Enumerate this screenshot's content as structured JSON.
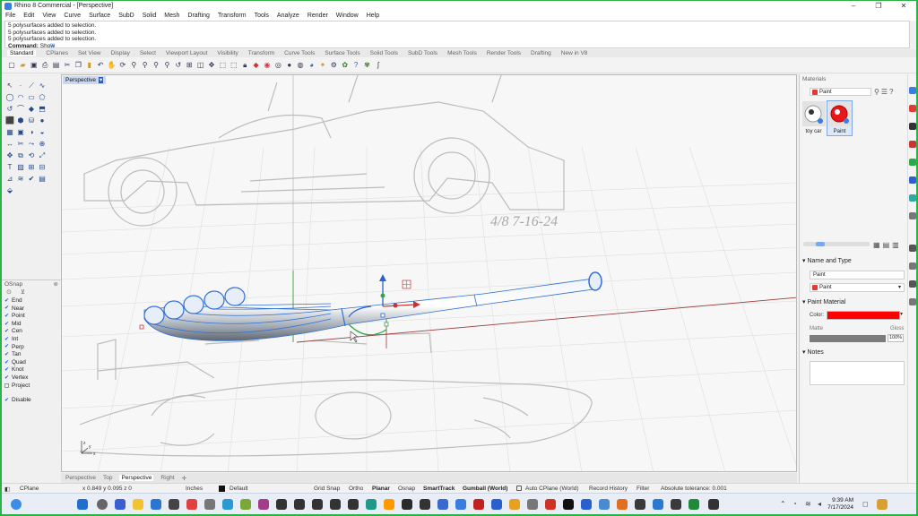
{
  "window": {
    "title": "Rhino 8 Commercial - [Perspective]",
    "controls": [
      "–",
      "❐",
      "✕"
    ]
  },
  "menu": [
    "File",
    "Edit",
    "View",
    "Curve",
    "Surface",
    "SubD",
    "Solid",
    "Mesh",
    "Drafting",
    "Transform",
    "Tools",
    "Analyze",
    "Render",
    "Window",
    "Help"
  ],
  "command_history": {
    "lines": [
      "5 polysurfaces added to selection.",
      "5 polysurfaces added to selection.",
      "5 polysurfaces added to selection."
    ],
    "prompt_label": "Command:",
    "typed_text": "Sho",
    "typed_highlight": "w"
  },
  "toolbar_tabs": [
    "Standard",
    "CPlanes",
    "Set View",
    "Display",
    "Select",
    "Viewport Layout",
    "Visibility",
    "Transform",
    "Curve Tools",
    "Surface Tools",
    "Solid Tools",
    "SubD Tools",
    "Mesh Tools",
    "Render Tools",
    "Drafting",
    "New in V8"
  ],
  "viewport": {
    "label": "Perspective",
    "sketch_date": "4/8 7-16-24"
  },
  "osnap": {
    "title": "OSnap",
    "items": [
      {
        "label": "End",
        "checked": true
      },
      {
        "label": "Near",
        "checked": true
      },
      {
        "label": "Point",
        "checked": true
      },
      {
        "label": "Mid",
        "checked": true
      },
      {
        "label": "Cen",
        "checked": true
      },
      {
        "label": "Int",
        "checked": true
      },
      {
        "label": "Perp",
        "checked": true
      },
      {
        "label": "Tan",
        "checked": true
      },
      {
        "label": "Quad",
        "checked": true
      },
      {
        "label": "Knot",
        "checked": true
      },
      {
        "label": "Vertex",
        "checked": true
      },
      {
        "label": "Project",
        "checked": false
      }
    ],
    "disable": {
      "label": "Disable",
      "checked": true
    }
  },
  "view_tabs": [
    "Perspective",
    "Top",
    "Perspective",
    "Right"
  ],
  "status": {
    "cplane": "CPlane",
    "coords": "x 0.849  y 0.095  z 0",
    "units": "Inches",
    "layer": "Default",
    "grid_snap": "Grid Snap",
    "ortho": "Ortho",
    "planar": "Planar",
    "osnap": "Osnap",
    "smarttrack": "SmartTrack",
    "gumball": "Gumball (World)",
    "auto_cplane": "Auto CPlane (World)",
    "record_history": "Record History",
    "filter": "Filter",
    "tolerance": "Absolute tolerance: 0.001"
  },
  "materials": {
    "title": "Materials",
    "search_value": "Paint",
    "thumbs": [
      {
        "label": "toy car",
        "selected": false
      },
      {
        "label": "Paint",
        "selected": true
      }
    ],
    "name_type_header": "Name and Type",
    "name_value": "Paint",
    "type_value": "Paint",
    "paint_header": "Paint Material",
    "color_label": "Color:",
    "color_value": "#ff0000",
    "matte_label": "Matte",
    "gloss_label": "Gloss",
    "gloss_value": "100%",
    "gloss_fraction": 1.0,
    "notes_header": "Notes"
  },
  "taskbar": {
    "time": "9:39 AM",
    "date": "7/17/2024"
  }
}
